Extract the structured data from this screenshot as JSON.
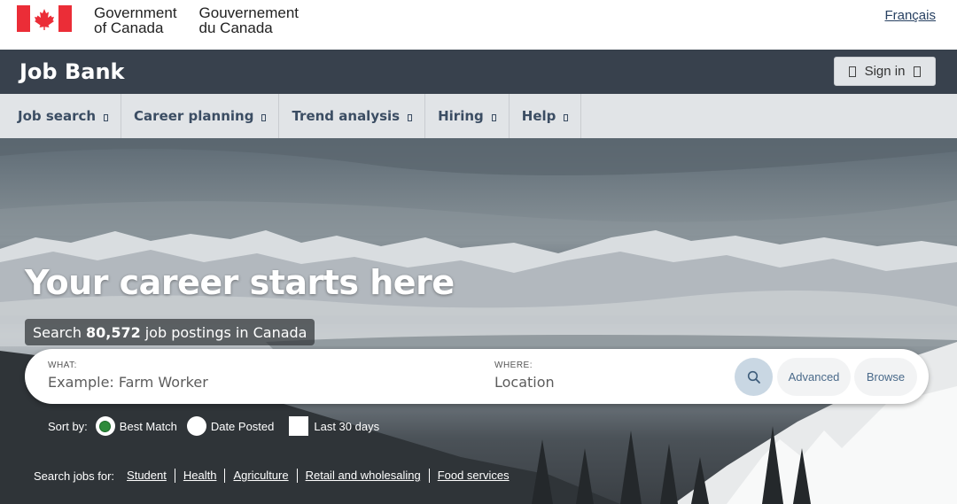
{
  "gov": {
    "name_en_line1": "Government",
    "name_en_line2": "of Canada",
    "name_fr_line1": "Gouvernement",
    "name_fr_line2": "du Canada",
    "language_link": "Français",
    "flag_colors": {
      "red": "#eb2d37",
      "white": "#ffffff"
    }
  },
  "app": {
    "title": "Job Bank",
    "signin_label": "Sign in"
  },
  "menu": [
    {
      "label": "Job search"
    },
    {
      "label": "Career planning"
    },
    {
      "label": "Trend analysis"
    },
    {
      "label": "Hiring"
    },
    {
      "label": "Help"
    }
  ],
  "hero": {
    "title": "Your career starts here",
    "sub_prefix": "Search",
    "postings_count": "80,572",
    "sub_suffix": "job postings in Canada"
  },
  "search": {
    "what_label": "WHAT:",
    "what_placeholder": "Example: Farm Worker",
    "where_label": "WHERE:",
    "where_placeholder": "Location",
    "search_icon": "search-icon",
    "advanced_label": "Advanced",
    "browse_label": "Browse"
  },
  "sort": {
    "label": "Sort by:",
    "options": [
      {
        "label": "Best Match",
        "selected": true
      },
      {
        "label": "Date Posted",
        "selected": false
      }
    ],
    "last30_label": "Last 30 days",
    "last30_checked": false
  },
  "quick_links": {
    "label": "Search jobs for:",
    "items": [
      "Student",
      "Health",
      "Agriculture",
      "Retail and wholesaling",
      "Food services"
    ]
  },
  "colors": {
    "header_bar": "#38414d",
    "menu_bg": "#e1e4e7",
    "menu_text": "#3b4d63",
    "radio_selected": "#2d8a3a",
    "link_blue": "#284162"
  }
}
